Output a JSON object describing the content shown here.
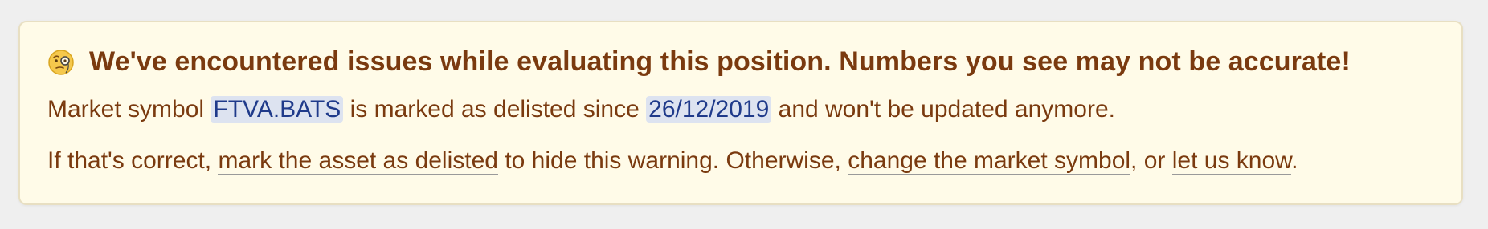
{
  "warning": {
    "icon": "face-with-monocle-icon",
    "title": "We've encountered issues while evaluating this position. Numbers you see may not be accurate!",
    "line1": {
      "prefix": "Market symbol ",
      "symbol": "FTVA.BATS",
      "middle": " is marked as delisted since ",
      "date": "26/12/2019",
      "suffix": " and won't be updated anymore."
    },
    "line2": {
      "prefix": "If that's correct, ",
      "link_mark_delisted": "mark the asset as delisted",
      "middle1": " to hide this warning. Otherwise, ",
      "link_change_symbol": "change the market symbol",
      "middle2": ", or ",
      "link_let_us_know": "let us know",
      "suffix": "."
    }
  },
  "colors": {
    "background": "#efefef",
    "box_background": "#fffbe8",
    "box_border": "#e8dfc2",
    "text": "#7a3a0f",
    "highlight_bg": "#dde3f0",
    "highlight_text": "#1f3a8a"
  }
}
